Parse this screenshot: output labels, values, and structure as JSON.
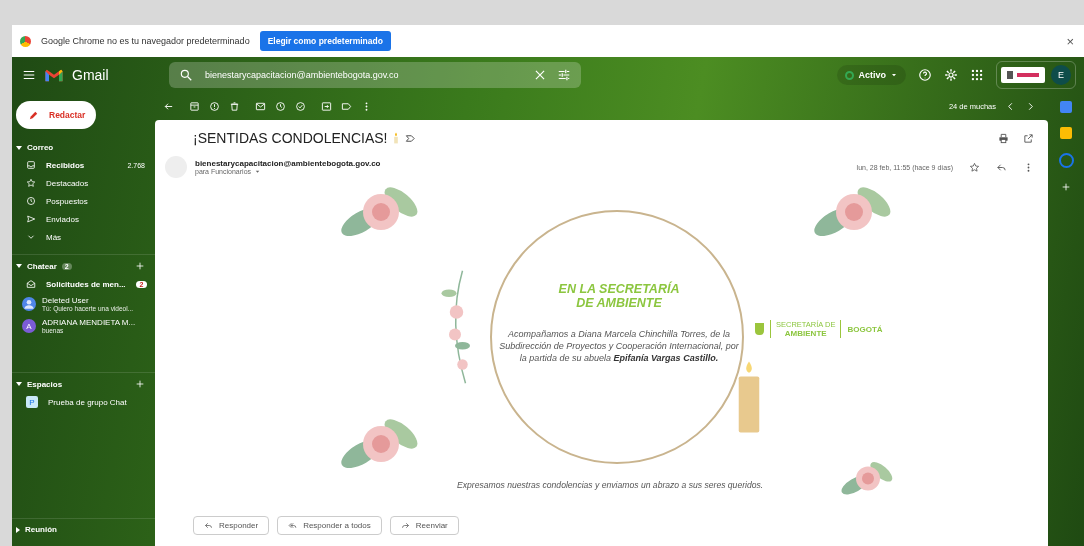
{
  "infobar": {
    "message": "Google Chrome no es tu navegador predeterminado",
    "button": "Elegir como predeterminado",
    "close": "×"
  },
  "header": {
    "logo_text": "Gmail",
    "search": {
      "value": "bienestarycapacitacion@ambientebogota.gov.co"
    },
    "status": {
      "label": "Activo",
      "color": "#34a853"
    },
    "avatar": "E"
  },
  "compose": "Redactar",
  "sidebar": {
    "sections": [
      {
        "title": "Correo",
        "expanded": true,
        "items": [
          {
            "label": "Recibidos",
            "count": "2.768",
            "unread": true
          },
          {
            "label": "Destacados",
            "unread": false
          },
          {
            "label": "Pospuestos",
            "unread": false
          },
          {
            "label": "Enviados",
            "unread": false
          },
          {
            "label": "Más",
            "unread": false
          }
        ]
      },
      {
        "title": "Chatear",
        "expanded": true,
        "badge": "2",
        "add": true,
        "items": [
          {
            "kind": "requests",
            "label": "Solicitudes de men...",
            "badge": "2",
            "unread": true
          },
          {
            "kind": "person",
            "label": "Deleted User",
            "subtitle": "Tú: Quiero hacerte una videol...",
            "unread": false,
            "color": "#4f86e8"
          },
          {
            "kind": "letter",
            "label": "ADRIANA MENDIETA M...",
            "subtitle": "buenas",
            "unread": false,
            "letter": "A",
            "color": "#7b5cd6"
          }
        ]
      },
      {
        "title": "Espacios",
        "expanded": true,
        "add": true,
        "items": [
          {
            "kind": "letter",
            "label": "Prueba de grupo Chat",
            "unread": false,
            "letter": "P",
            "color": "#c9e8f8"
          }
        ]
      },
      {
        "title": "Reunión",
        "expanded": false
      }
    ]
  },
  "toolbar": {
    "pager": "24 de muchas"
  },
  "email": {
    "subject": "¡SENTIDAS CONDOLENCIAS!",
    "sender": "bienestarycapacitacion@ambientebogota.gov.co",
    "recipients": "para Funcionarios",
    "date": "lun, 28 feb, 11:55 (hace 9 días)",
    "starred": false,
    "card": {
      "title_lines": [
        "EN LA SECRETARÍA",
        "DE AMBIENTE"
      ],
      "paragraph": "Acompañamos a Diana Marcela Chinchilla Torres, de la Subdirección de Proyectos y Cooperación Internacional, por la partida de su abuela",
      "name": "Epifanía Vargas Castillo.",
      "logo_secretaria_small": "SECRETARÍA DE",
      "logo_secretaria": "AMBIENTE",
      "logo_city": "BOGOTÁ",
      "footer": "Expresamos nuestras condolencias y enviamos un abrazo a sus seres queridos."
    },
    "actions": [
      "Responder",
      "Responder a todos",
      "Reenviar"
    ]
  }
}
